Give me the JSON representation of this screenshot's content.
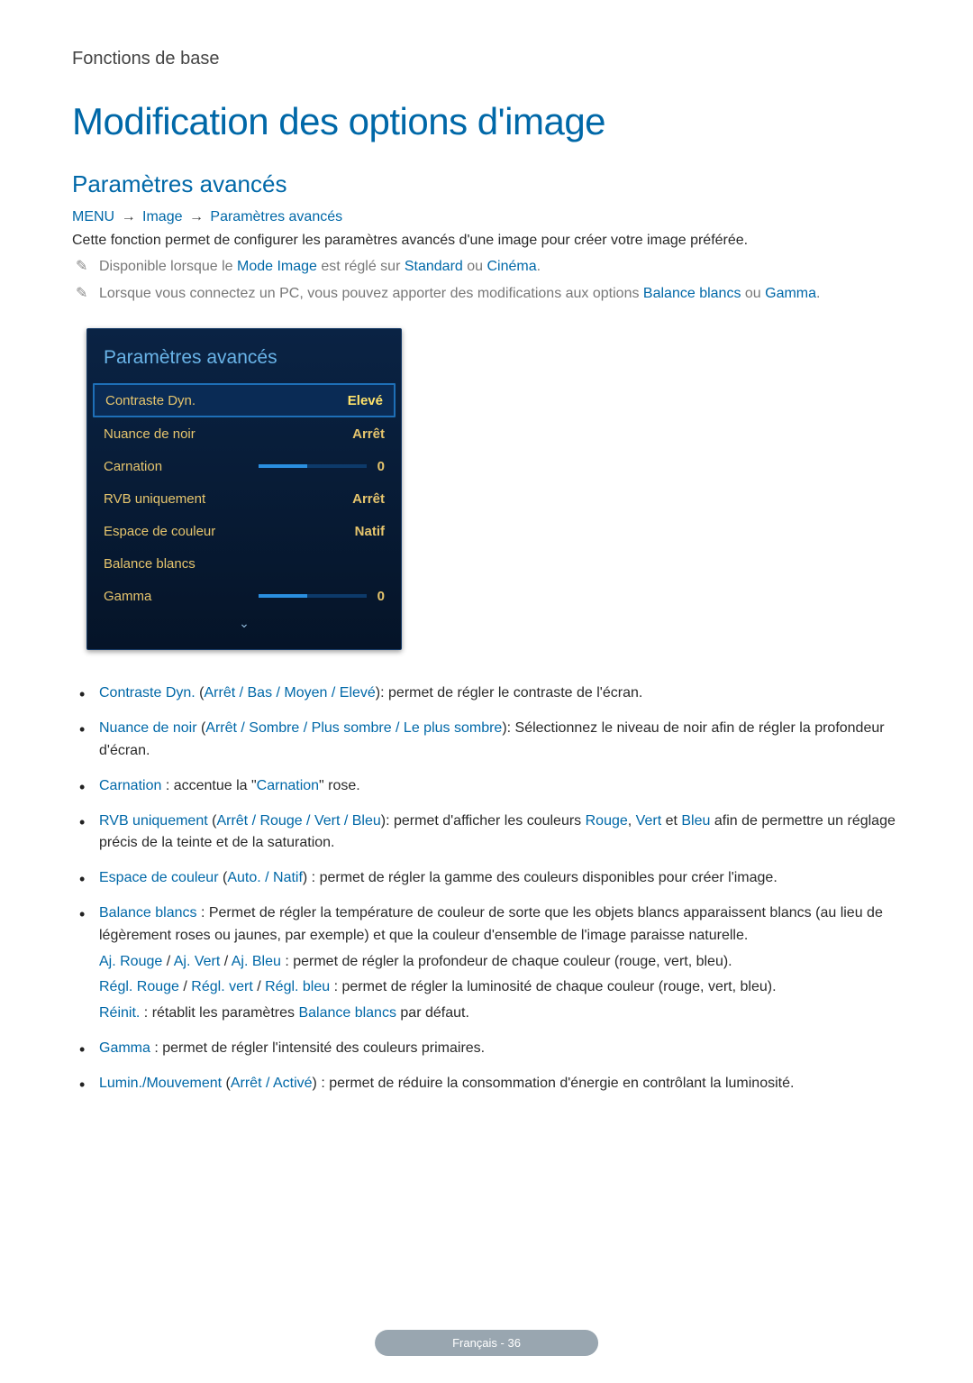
{
  "chapter": "Fonctions de base",
  "title": "Modification des options d'image",
  "section": "Paramètres avancés",
  "breadcrumb": {
    "menu": "MENU",
    "image": "Image",
    "params": "Paramètres avancés"
  },
  "intro": "Cette fonction permet de configurer les paramètres avancés d'une image pour créer votre image préférée.",
  "notes": {
    "n1_pre": "Disponible lorsque le ",
    "n1_mode": "Mode Image",
    "n1_mid": " est réglé sur ",
    "n1_std": "Standard",
    "n1_or": " ou ",
    "n1_cin": "Cinéma",
    "n1_dot": ".",
    "n2_pre": "Lorsque vous connectez un PC, vous pouvez apporter des modifications aux options ",
    "n2_bb": "Balance blancs",
    "n2_or": " ou ",
    "n2_g": "Gamma",
    "n2_dot": "."
  },
  "panel": {
    "title": "Paramètres avancés",
    "rows": [
      {
        "label": "Contraste Dyn.",
        "value": "Elevé"
      },
      {
        "label": "Nuance de noir",
        "value": "Arrêt"
      },
      {
        "label": "Carnation",
        "value": "0"
      },
      {
        "label": "RVB uniquement",
        "value": "Arrêt"
      },
      {
        "label": "Espace de couleur",
        "value": "Natif"
      },
      {
        "label": "Balance blancs",
        "value": ""
      },
      {
        "label": "Gamma",
        "value": "0"
      }
    ]
  },
  "bullets": {
    "b1": {
      "name": "Contraste Dyn.",
      "opts": "Arrêt / Bas / Moyen / Elevé",
      "desc": "): permet de régler le contraste de l'écran."
    },
    "b2": {
      "name": "Nuance de noir",
      "opts": "Arrêt / Sombre / Plus sombre / Le plus sombre",
      "desc": "): Sélectionnez le niveau de noir afin de régler la profondeur d'écran."
    },
    "b3": {
      "name": "Carnation",
      "mid": " : accentue la \"",
      "ref": "Carnation",
      "end": "\" rose."
    },
    "b4": {
      "name": "RVB uniquement",
      "opts": "Arrêt / Rouge / Vert / Bleu",
      "mid": "): permet d'afficher les couleurs ",
      "r": "Rouge",
      "c1": ", ",
      "v": "Vert",
      "c2": " et ",
      "b": "Bleu",
      "end": " afin de permettre un réglage précis de la teinte et de la saturation."
    },
    "b5": {
      "name": "Espace de couleur",
      "opts": "Auto. / Natif",
      "desc": ") : permet de régler la gamme des couleurs disponibles pour créer l'image."
    },
    "b6": {
      "name": "Balance blancs",
      "desc": " : Permet de régler la température de couleur de sorte que les objets blancs apparaissent blancs (au lieu de légèrement roses ou jaunes, par exemple) et que la couleur d'ensemble de l'image paraisse naturelle.",
      "l2_a": "Aj. Rouge",
      "l2_b": "Aj. Vert",
      "l2_c": "Aj. Bleu",
      "l2_desc": " : permet de régler la profondeur de chaque couleur (rouge, vert, bleu).",
      "l3_a": "Régl. Rouge",
      "l3_b": "Régl. vert",
      "l3_c": "Régl. bleu",
      "l3_desc": " : permet de régler la luminosité de chaque couleur (rouge, vert, bleu).",
      "l4_a": "Réinit.",
      "l4_mid": " : rétablit les paramètres ",
      "l4_b": "Balance blancs",
      "l4_end": " par défaut."
    },
    "b7": {
      "name": "Gamma",
      "desc": " : permet de régler l'intensité des couleurs primaires."
    },
    "b8": {
      "name": "Lumin./Mouvement",
      "opts": "Arrêt / Activé",
      "desc": ") : permet de réduire la consommation d'énergie en contrôlant la luminosité."
    }
  },
  "sep": " / ",
  "open": " (",
  "footer": "Français - 36"
}
